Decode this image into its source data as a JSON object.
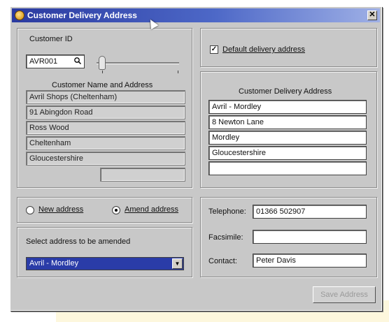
{
  "window": {
    "title": "Customer Delivery Address",
    "close_label": "✕"
  },
  "customer": {
    "id_label": "Customer ID",
    "id_value": "AVR001",
    "lookup_icon": "magnifier-icon",
    "name_address_label": "Customer Name and Address",
    "address_lines": [
      "Avril Shops (Cheltenham)",
      "91 Abingdon Road",
      "Ross Wood",
      "Cheltenham",
      "Gloucestershire",
      ""
    ]
  },
  "default_delivery": {
    "label": "Default delivery address",
    "checked": true
  },
  "delivery_address": {
    "label": "Customer Delivery Address",
    "lines": [
      "Avril - Mordley",
      "8 Newton Lane",
      "Mordley",
      "Gloucestershire",
      ""
    ]
  },
  "mode": {
    "new_label": "New address",
    "amend_label": "Amend address",
    "selected": "amend"
  },
  "select_address": {
    "label": "Select address to be amended",
    "value": "Avril - Mordley"
  },
  "contact": {
    "telephone_label": "Telephone:",
    "telephone_value": "01366 502907",
    "facsimile_label": "Facsimile:",
    "facsimile_value": "",
    "contact_label": "Contact:",
    "contact_value": "Peter Davis"
  },
  "buttons": {
    "save_label": "Save Address"
  },
  "colors": {
    "title_start": "#2a3aa0",
    "title_end": "#9fb0e6",
    "dialog_bg": "#c8c8c8",
    "select_bg": "#2a3ca8"
  }
}
